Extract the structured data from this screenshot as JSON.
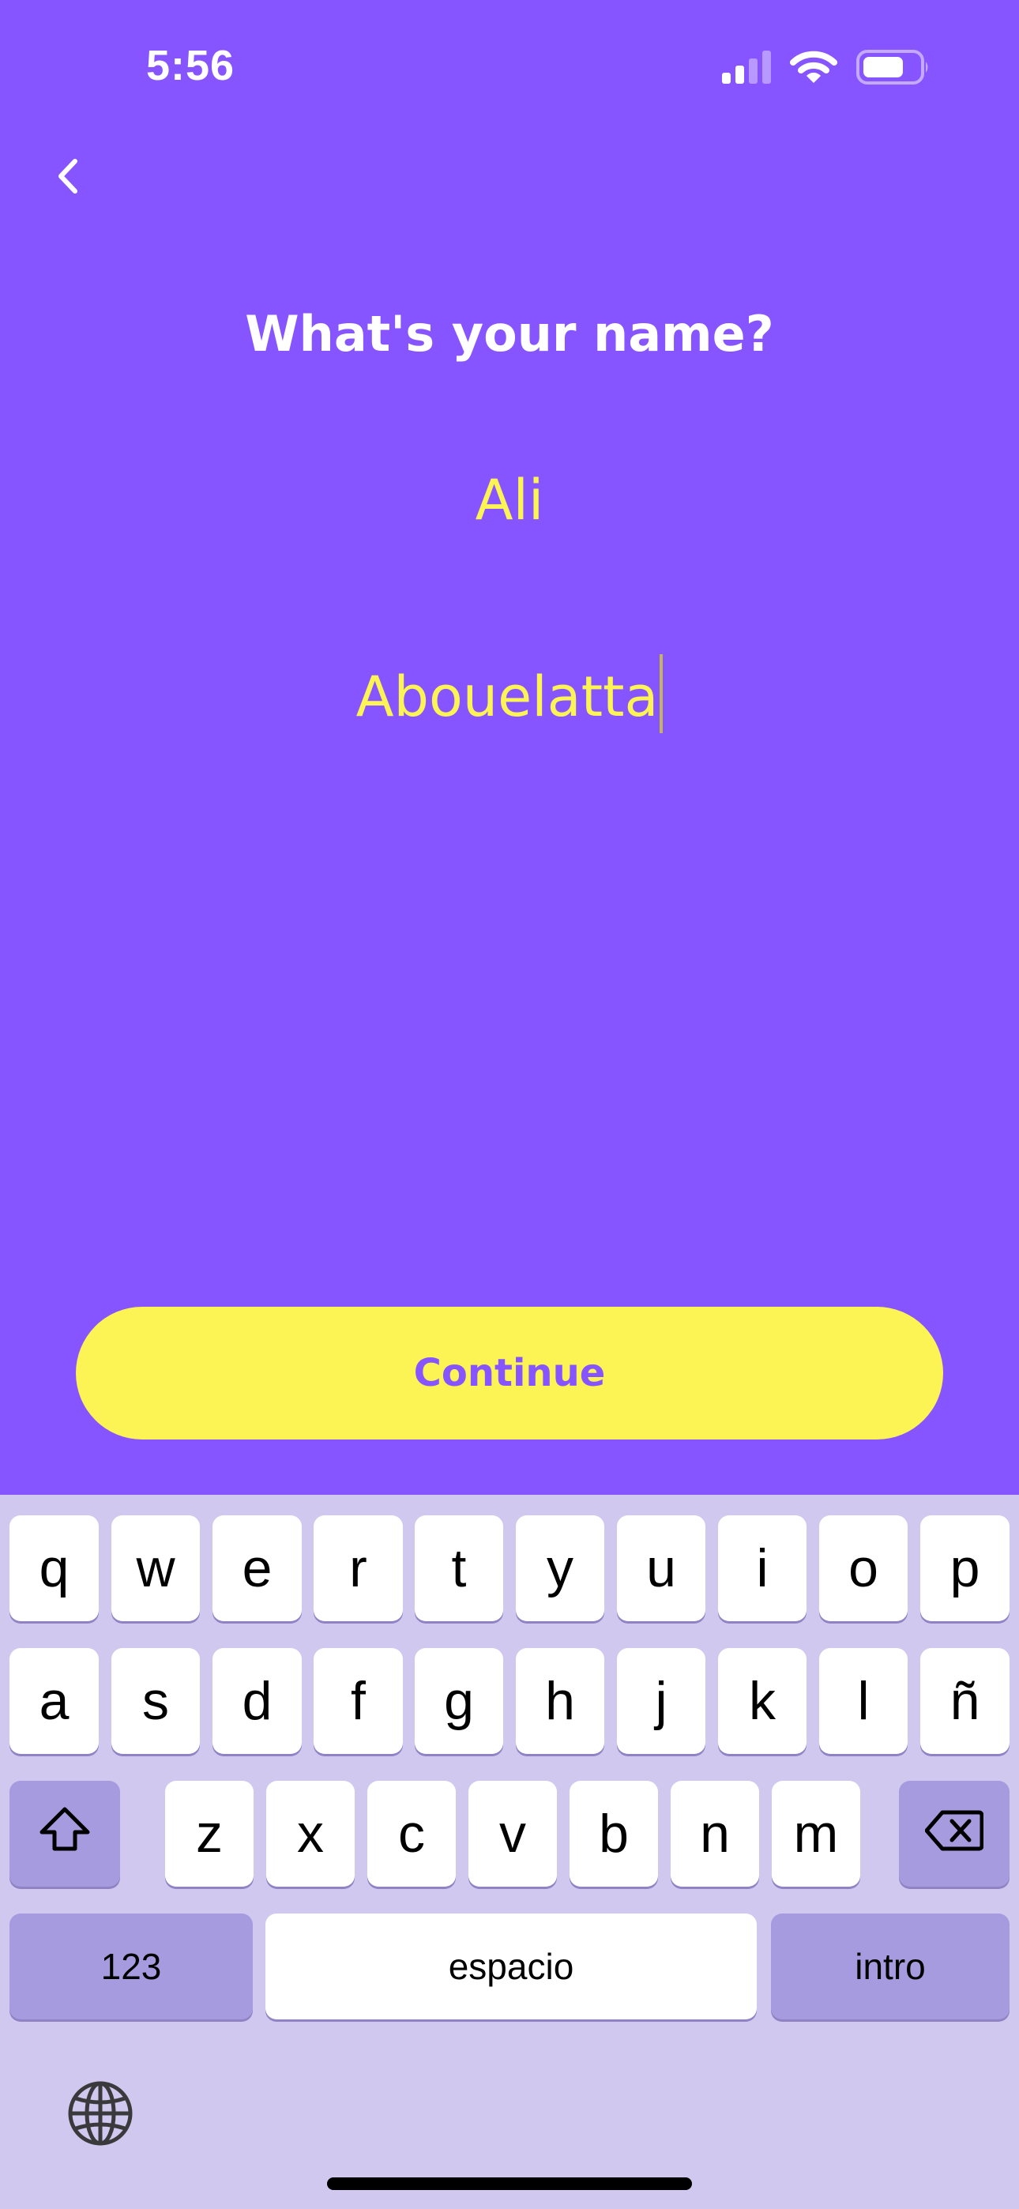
{
  "status_bar": {
    "time": "5:56",
    "icons": [
      "cellular-signal-icon",
      "wifi-icon",
      "battery-icon"
    ]
  },
  "header": {
    "back_icon": "chevron-left-icon"
  },
  "form": {
    "title": "What's your name?",
    "first_name_value": "Ali",
    "last_name_value": "Abouelatta"
  },
  "actions": {
    "continue_label": "Continue"
  },
  "keyboard": {
    "row1": [
      "q",
      "w",
      "e",
      "r",
      "t",
      "y",
      "u",
      "i",
      "o",
      "p"
    ],
    "row2": [
      "a",
      "s",
      "d",
      "f",
      "g",
      "h",
      "j",
      "k",
      "l",
      "ñ"
    ],
    "row3": [
      "z",
      "x",
      "c",
      "v",
      "b",
      "n",
      "m"
    ],
    "numbers_label": "123",
    "space_label": "espacio",
    "return_label": "intro",
    "shift_icon": "shift-icon",
    "delete_icon": "backspace-icon",
    "globe_icon": "globe-icon"
  },
  "colors": {
    "background": "#8755FF",
    "accent": "#FCF454",
    "keyboard_bg": "#D0C8EE",
    "function_key": "#A59BDE"
  }
}
